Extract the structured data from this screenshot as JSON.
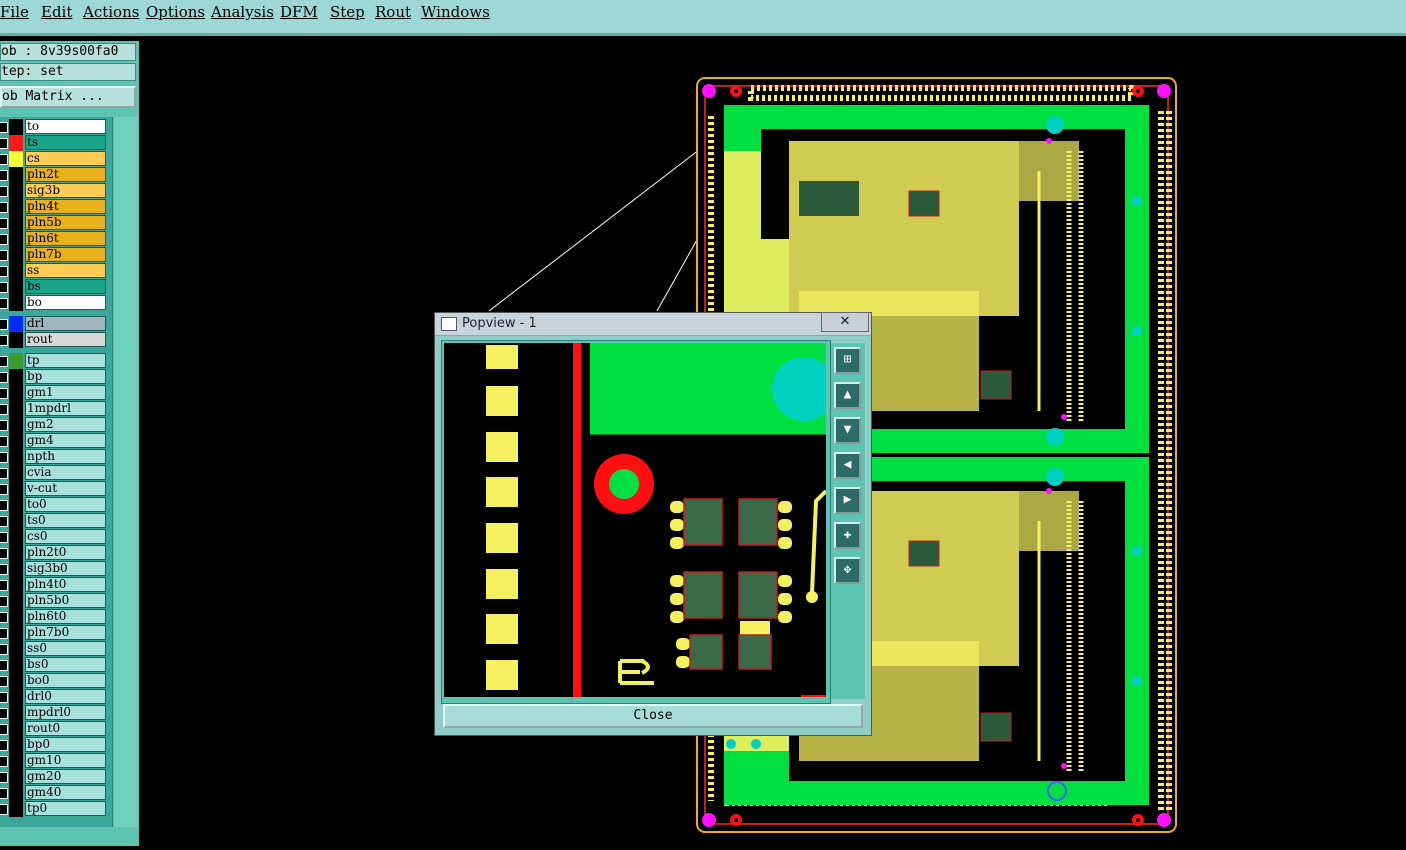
{
  "menubar": {
    "items": [
      {
        "label": "File"
      },
      {
        "label": "Edit"
      },
      {
        "label": "Actions"
      },
      {
        "label": "Options"
      },
      {
        "label": "Analysis"
      },
      {
        "label": "DFM"
      },
      {
        "label": "Step"
      },
      {
        "label": "Rout"
      },
      {
        "label": "Windows"
      }
    ]
  },
  "sidebar": {
    "job_label": "ob : 8v39s00fa0",
    "step_label": "tep: set",
    "job_matrix_label": "ob Matrix ...",
    "layers": [
      {
        "name": "to",
        "color": "#ffffff",
        "swatch": "#000000"
      },
      {
        "name": "ts",
        "color": "#19a58a",
        "swatch": "#ff1a1a"
      },
      {
        "name": "cs",
        "color": "#ffcc55",
        "swatch": "#ffff33"
      },
      {
        "name": "pln2t",
        "color": "#e8b01a",
        "swatch": "#000000"
      },
      {
        "name": "sig3b",
        "color": "#ffcc55",
        "swatch": "#000000"
      },
      {
        "name": "pln4t",
        "color": "#e8b01a",
        "swatch": "#000000"
      },
      {
        "name": "pln5b",
        "color": "#e8b01a",
        "swatch": "#000000"
      },
      {
        "name": "pln6t",
        "color": "#e8b01a",
        "swatch": "#000000"
      },
      {
        "name": "pln7b",
        "color": "#e8b01a",
        "swatch": "#000000"
      },
      {
        "name": "ss",
        "color": "#ffcc55",
        "swatch": "#000000"
      },
      {
        "name": "bs",
        "color": "#19a58a",
        "swatch": "#000000"
      },
      {
        "name": "bo",
        "color": "#ffffff",
        "swatch": "#000000"
      },
      {
        "name": "drl",
        "color": "#a0b4be",
        "swatch": "#0a2aff"
      },
      {
        "name": "rout",
        "color": "#d8d8d8",
        "swatch": "#000000"
      },
      {
        "name": "tp",
        "color": "#a8e0dc",
        "swatch": "#3a9a2a"
      },
      {
        "name": "bp",
        "color": "#a8e0dc",
        "swatch": "#000000"
      },
      {
        "name": "gm1",
        "color": "#a8e0dc",
        "swatch": "#000000"
      },
      {
        "name": "1mpdrl",
        "color": "#a8e0dc",
        "swatch": "#000000"
      },
      {
        "name": "gm2",
        "color": "#a8e0dc",
        "swatch": "#000000"
      },
      {
        "name": "gm4",
        "color": "#a8e0dc",
        "swatch": "#000000"
      },
      {
        "name": "npth",
        "color": "#a8e0dc",
        "swatch": "#000000"
      },
      {
        "name": "cvia",
        "color": "#a8e0dc",
        "swatch": "#000000"
      },
      {
        "name": "v-cut",
        "color": "#a8e0dc",
        "swatch": "#000000"
      },
      {
        "name": "to0",
        "color": "#a8e0dc",
        "swatch": "#000000"
      },
      {
        "name": "ts0",
        "color": "#a8e0dc",
        "swatch": "#000000"
      },
      {
        "name": "cs0",
        "color": "#a8e0dc",
        "swatch": "#000000"
      },
      {
        "name": "pln2t0",
        "color": "#a8e0dc",
        "swatch": "#000000"
      },
      {
        "name": "sig3b0",
        "color": "#a8e0dc",
        "swatch": "#000000"
      },
      {
        "name": "pln4t0",
        "color": "#a8e0dc",
        "swatch": "#000000"
      },
      {
        "name": "pln5b0",
        "color": "#a8e0dc",
        "swatch": "#000000"
      },
      {
        "name": "pln6t0",
        "color": "#a8e0dc",
        "swatch": "#000000"
      },
      {
        "name": "pln7b0",
        "color": "#a8e0dc",
        "swatch": "#000000"
      },
      {
        "name": "ss0",
        "color": "#a8e0dc",
        "swatch": "#000000"
      },
      {
        "name": "bs0",
        "color": "#a8e0dc",
        "swatch": "#000000"
      },
      {
        "name": "bo0",
        "color": "#a8e0dc",
        "swatch": "#000000"
      },
      {
        "name": "drl0",
        "color": "#a8e0dc",
        "swatch": "#000000"
      },
      {
        "name": "mpdrl0",
        "color": "#a8e0dc",
        "swatch": "#000000"
      },
      {
        "name": "rout0",
        "color": "#a8e0dc",
        "swatch": "#000000"
      },
      {
        "name": "bp0",
        "color": "#a8e0dc",
        "swatch": "#000000"
      },
      {
        "name": "gm10",
        "color": "#a8e0dc",
        "swatch": "#000000"
      },
      {
        "name": "gm20",
        "color": "#a8e0dc",
        "swatch": "#000000"
      },
      {
        "name": "gm40",
        "color": "#a8e0dc",
        "swatch": "#000000"
      },
      {
        "name": "tp0",
        "color": "#a8e0dc",
        "swatch": "#000000"
      }
    ]
  },
  "popview": {
    "title": "Popview - 1",
    "close_x": "✕",
    "close_label": "Close",
    "tools": [
      {
        "icon": "zoom-fit-icon"
      },
      {
        "icon": "pan-up-icon"
      },
      {
        "icon": "pan-down-icon"
      },
      {
        "icon": "pan-left-icon"
      },
      {
        "icon": "pan-right-icon"
      },
      {
        "icon": "zoom-in-icon"
      },
      {
        "icon": "zoom-out-icon"
      }
    ]
  },
  "colors": {
    "pcb_green": "#00e040",
    "pcb_yellow": "#f4f060",
    "pcb_red": "#ff1010",
    "pcb_magenta": "#ff10ff",
    "pcb_cyan": "#00d0c0",
    "panel_teal": "#5cc4b0"
  }
}
